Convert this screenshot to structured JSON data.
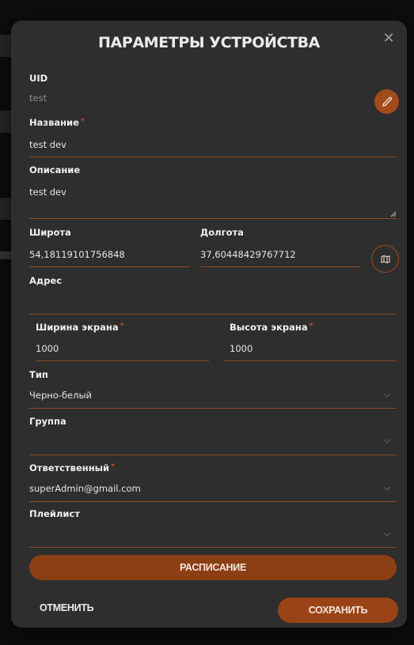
{
  "modal": {
    "title": "ПАРАМЕТРЫ УСТРОЙСТВА",
    "close_glyph": "✕"
  },
  "fields": {
    "uid": {
      "label": "UID",
      "value": "test"
    },
    "name": {
      "label": "Название",
      "value": "test dev",
      "required_mark": "*"
    },
    "description": {
      "label": "Описание",
      "value": "test dev"
    },
    "latitude": {
      "label": "Широта",
      "value": "54,18119101756848"
    },
    "longitude": {
      "label": "Долгота",
      "value": "37,60448429767712"
    },
    "address": {
      "label": "Адрес",
      "value": ""
    },
    "screen_width": {
      "label": "Ширина экрана",
      "value": "1000",
      "required_mark": "*"
    },
    "screen_height": {
      "label": "Высота экрана",
      "value": "1000",
      "required_mark": "*"
    },
    "type": {
      "label": "Тип",
      "value": "Черно-белый"
    },
    "group": {
      "label": "Группа",
      "value": ""
    },
    "responsible": {
      "label": "Ответственный",
      "value": "superAdmin@gmail.com",
      "required_mark": "*"
    },
    "playlist": {
      "label": "Плейлист",
      "value": ""
    }
  },
  "buttons": {
    "schedule": "РАСПИСАНИЕ",
    "cancel": "ОТМЕНИТЬ",
    "save": "СОХРАНИТЬ"
  },
  "colors": {
    "accent": "#a24a1a",
    "underline": "#8f4a22",
    "modal_bg": "#2e2e2e",
    "required": "#d9592c"
  },
  "icons": {
    "edit": "pencil-icon",
    "map": "map-icon",
    "close": "close-icon",
    "select": "chevron-down-icon"
  }
}
